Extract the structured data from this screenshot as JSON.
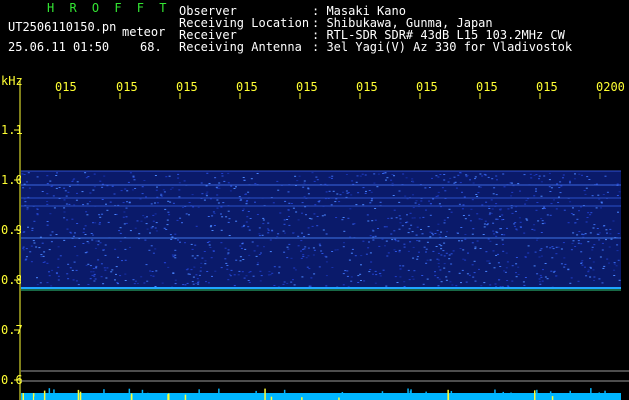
{
  "header": {
    "brand": "H R O F F T",
    "filename": "UT2506110150.pn",
    "tag": "meteor",
    "datetime": "25.06.11 01:50",
    "count": "68.",
    "fields": [
      {
        "label": "Observer",
        "value": ": Masaki Kano"
      },
      {
        "label": "Receiving Location",
        "value": ": Shibukawa, Gunma, Japan"
      },
      {
        "label": "Receiver",
        "value": ": RTL-SDR SDR# 43dB L15 103.2MHz CW"
      },
      {
        "label": "Receiving Antenna",
        "value": ": 3el Yagi(V) Az 330 for Vladivostok"
      }
    ]
  },
  "y_axis": {
    "unit": "kHz",
    "ticks": [
      "1.1",
      "1.0",
      "0.9",
      "0.8",
      "0.7",
      "0.6"
    ]
  },
  "time_ticks": [
    "015",
    "015",
    "015",
    "015",
    "015",
    "015",
    "015",
    "015",
    "015",
    "0200"
  ],
  "colors": {
    "background": "#000000",
    "text": "#ffffff",
    "brand": "#33e633",
    "ticks": "#ffff33",
    "noise": "#1a2aa0",
    "echo": "#00c0ff"
  }
}
